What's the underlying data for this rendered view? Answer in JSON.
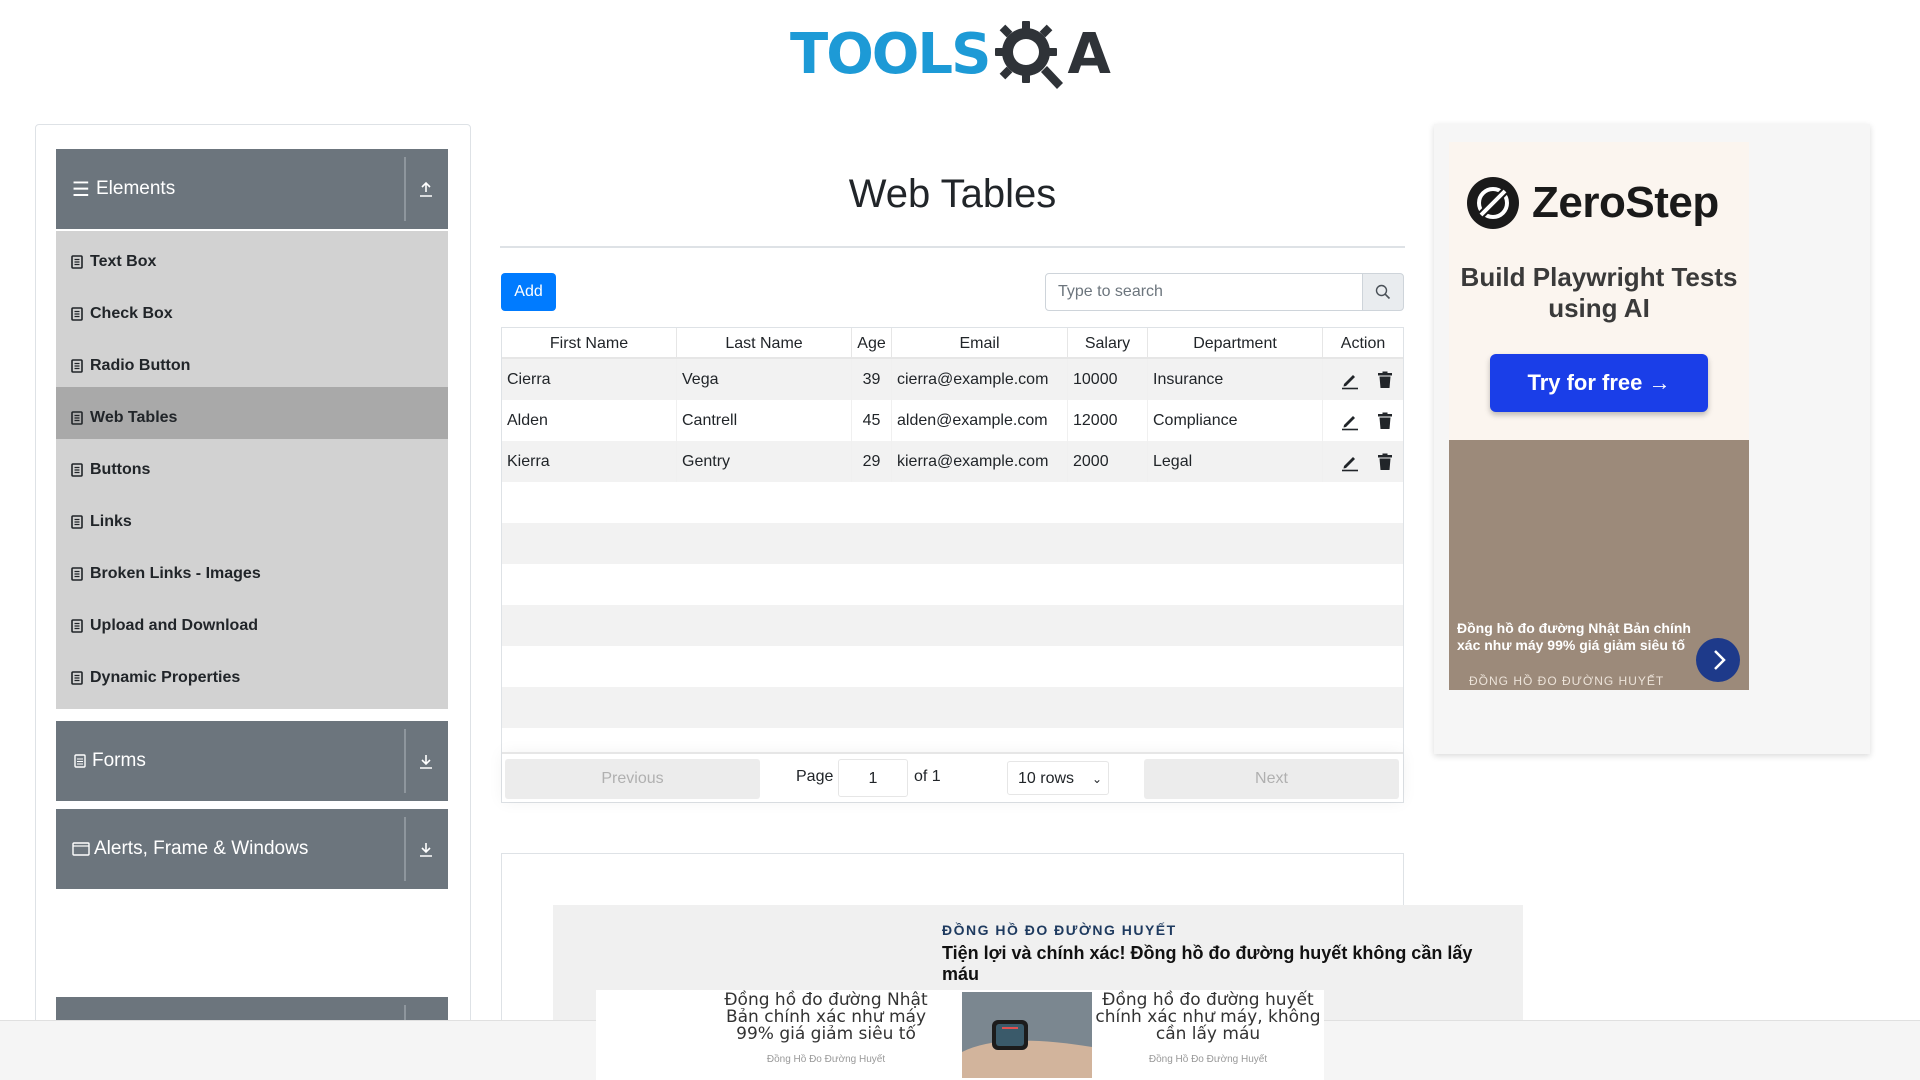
{
  "logo": {
    "part1": "TOOLS",
    "part2": "A"
  },
  "sidebar": {
    "groups": [
      {
        "label": "Elements"
      },
      {
        "label": "Forms"
      },
      {
        "label": "Alerts, Frame & Windows"
      }
    ],
    "items": [
      {
        "label": "Text Box"
      },
      {
        "label": "Check Box"
      },
      {
        "label": "Radio Button"
      },
      {
        "label": "Web Tables"
      },
      {
        "label": "Buttons"
      },
      {
        "label": "Links"
      },
      {
        "label": "Broken Links - Images"
      },
      {
        "label": "Upload and Download"
      },
      {
        "label": "Dynamic Properties"
      }
    ]
  },
  "main": {
    "title": "Web Tables",
    "add_label": "Add",
    "search_placeholder": "Type to search"
  },
  "table": {
    "headers": [
      "First Name",
      "Last Name",
      "Age",
      "Email",
      "Salary",
      "Department",
      "Action"
    ],
    "rows": [
      [
        "Cierra",
        "Vega",
        "39",
        "cierra@example.com",
        "10000",
        "Insurance"
      ],
      [
        "Alden",
        "Cantrell",
        "45",
        "alden@example.com",
        "12000",
        "Compliance"
      ],
      [
        "Kierra",
        "Gentry",
        "29",
        "kierra@example.com",
        "2000",
        "Legal"
      ]
    ]
  },
  "pager": {
    "previous": "Previous",
    "next": "Next",
    "page_label": "Page",
    "page_value": "1",
    "of_label": "of 1",
    "rows_label": "10 rows"
  },
  "ad_right": {
    "brand": "ZeroStep",
    "tagline": "Build Playwright Tests using AI",
    "cta": "Try for free →",
    "caption": "Đồng hồ đo đường Nhật Bản chính xác như máy 99% giá giảm siêu tố",
    "sub_brand": "ĐỒNG HỒ ĐO ĐƯỜNG HUYẾT"
  },
  "ad_mid": {
    "brand": "ĐỒNG HỒ ĐO ĐƯỜNG HUYẾT",
    "headline": "Tiện lợi và chính xác! Đồng hồ đo đường huyết không cần lấy máu"
  },
  "ad_strip": {
    "left_text": "Đồng hồ đo đường Nhật Bản chính xác như máy 99% giá giảm siêu tố",
    "left_sub": "Đồng Hồ Đo Đường Huyết",
    "right_text": "Đồng hồ đo đường huyết chính xác như máy, không cần lấy máu",
    "right_sub": "Đồng Hồ Đo Đường Huyết"
  },
  "colors": {
    "sidebar_header": "#6c757d",
    "menu_item": "#d2d2d2",
    "menu_active": "#a9a9a9",
    "primary": "#007bff",
    "logo_blue": "#1d9ad6"
  }
}
